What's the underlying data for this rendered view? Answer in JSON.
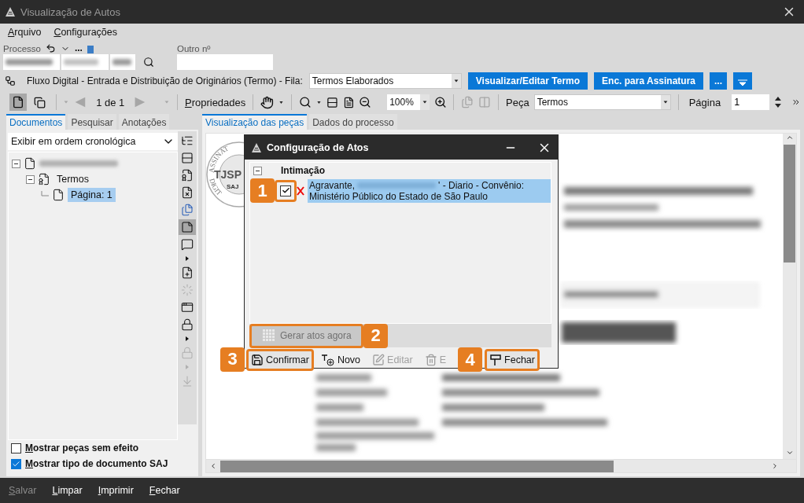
{
  "window": {
    "title": "Visualização de Autos"
  },
  "menu": [
    {
      "label": "Arquivo"
    },
    {
      "label": "Configurações"
    }
  ],
  "process": {
    "label": "Processo",
    "more": "...",
    "other_label": "Outro nº"
  },
  "flow": {
    "label": "Fluxo Digital - Entrada e Distribuição de Originários (Termo) - Fila:",
    "queue": "Termos Elaborados",
    "buttons": [
      "Visualizar/Editar Termo",
      "Enc. para Assinatura",
      "..."
    ]
  },
  "toolbar": {
    "view_modes": [
      {
        "selected": true
      },
      {
        "selected": false
      }
    ],
    "nav_disabled": true,
    "page_indicator": "1 de 1",
    "properties": "Propriedades",
    "zoom": "100%",
    "copy_disabled": true,
    "piece_label": "Peça",
    "piece": "Termos",
    "page_label": "Página",
    "page": "1"
  },
  "left_panel": {
    "tabs": [
      {
        "label": "Documentos",
        "selected": true
      },
      {
        "label": "Pesquisar",
        "selected": false
      },
      {
        "label": "Anotações",
        "selected": false
      }
    ],
    "order": "Exibir em ordem cronológica",
    "tree": [
      {
        "kind": "process",
        "expanded": true,
        "children": [
          {
            "kind": "group",
            "label": "Termos",
            "expanded": true,
            "selected": false,
            "children": [
              {
                "kind": "page",
                "label": "Página: 1",
                "selected": true
              }
            ]
          }
        ]
      }
    ],
    "side_tools": [
      {
        "kind": "tree",
        "selected": false,
        "disabled": false
      },
      {
        "kind": "layers",
        "selected": false,
        "disabled": false
      },
      {
        "kind": "certificate",
        "selected": false,
        "disabled": false
      },
      {
        "kind": "doc-x",
        "selected": false,
        "disabled": false
      },
      {
        "kind": "compare",
        "selected": false,
        "disabled": false
      },
      {
        "kind": "note",
        "selected": true,
        "disabled": false
      },
      {
        "kind": "note-list",
        "selected": false,
        "disabled": false
      },
      {
        "kind": "caret",
        "selected": false,
        "disabled": false
      },
      {
        "kind": "note-add",
        "selected": false,
        "disabled": false
      },
      {
        "kind": "dots",
        "selected": false,
        "disabled": true
      },
      {
        "kind": "window",
        "selected": false,
        "disabled": false
      },
      {
        "kind": "lock",
        "selected": false,
        "disabled": false
      },
      {
        "kind": "caret",
        "selected": false,
        "disabled": false
      },
      {
        "kind": "lock",
        "selected": false,
        "disabled": true
      },
      {
        "kind": "caret",
        "selected": false,
        "disabled": true
      },
      {
        "kind": "download",
        "selected": false,
        "disabled": true
      }
    ],
    "options": [
      {
        "label": "Mostrar peças sem efeito",
        "checked": false
      },
      {
        "label": "Mostrar tipo de documento SAJ",
        "checked": true
      }
    ]
  },
  "viewer": {
    "tabs": [
      {
        "label": "Visualização das peças",
        "selected": true
      },
      {
        "label": "Dados do processo",
        "selected": false
      }
    ],
    "seal": {
      "top": "ASSINAT",
      "center": "TJSP",
      "small": "SAJ",
      "bottom": "DIGIT"
    }
  },
  "dialog": {
    "title": "Configuração de Atos",
    "group": "Intimação",
    "group_expanded": true,
    "items": [
      {
        "checked": true,
        "selected": true,
        "callout": "1",
        "role": "Agravante,",
        "text": "' - Diario - Convênio:",
        "text2": "Ministério Público do Estado de São Paulo"
      }
    ],
    "generate": {
      "label": "Gerar atos agora",
      "disabled": true,
      "callout": "2"
    },
    "actions": [
      {
        "kind": "save",
        "label": "Confirmar",
        "disabled": false,
        "callout": "3"
      },
      {
        "kind": "new",
        "label": "Novo",
        "disabled": false
      },
      {
        "kind": "edit",
        "label": "Editar",
        "disabled": true
      },
      {
        "kind": "delete",
        "label": "E",
        "disabled": true
      },
      {
        "kind": "close",
        "label": "Fechar",
        "disabled": false,
        "callout": "4"
      }
    ]
  },
  "footer": [
    {
      "label": "Salvar",
      "disabled": true
    },
    {
      "label": "Limpar",
      "disabled": false
    },
    {
      "label": "Imprimir",
      "disabled": false
    },
    {
      "label": "Fechar",
      "disabled": false
    }
  ]
}
